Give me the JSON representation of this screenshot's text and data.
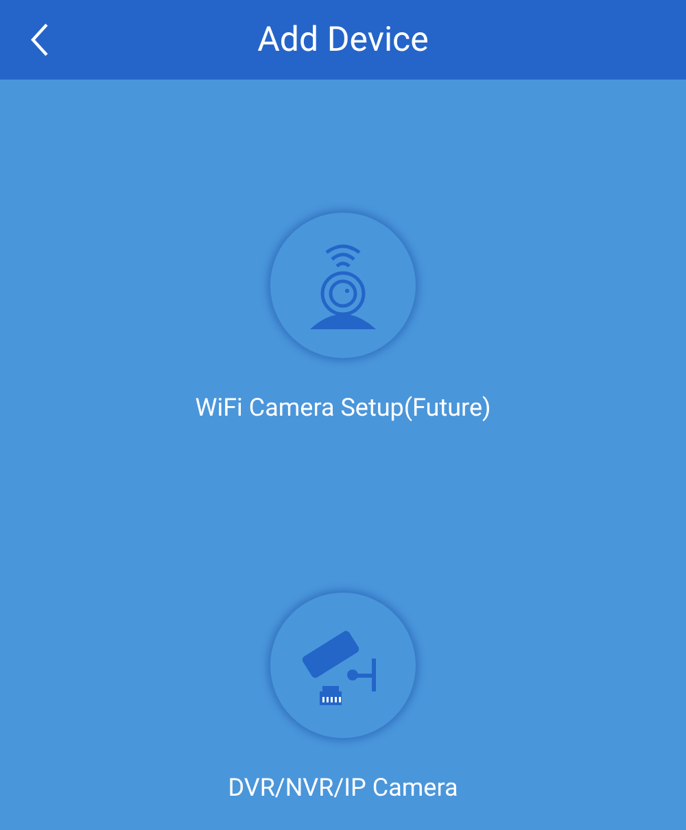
{
  "header": {
    "title": "Add Device"
  },
  "options": [
    {
      "kind": "wifi",
      "label": "WiFi Camera Setup(Future)"
    },
    {
      "kind": "wired",
      "label": "DVR/NVR/IP Camera"
    }
  ]
}
